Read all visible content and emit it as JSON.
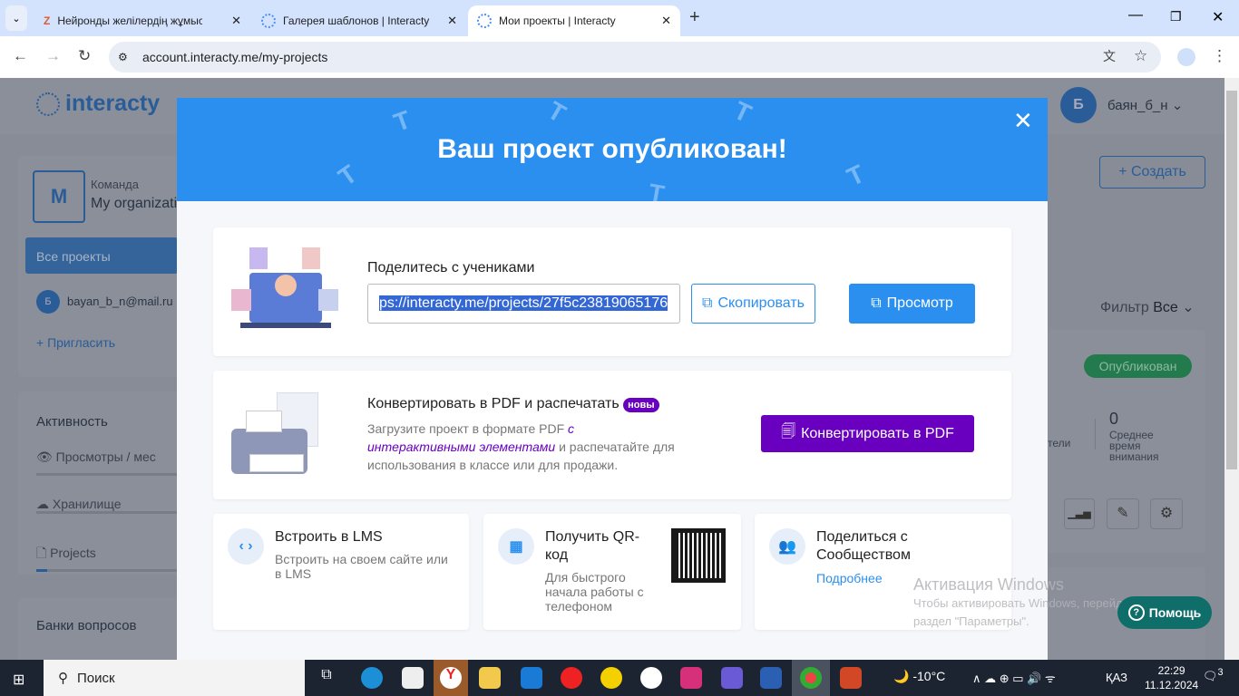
{
  "browser": {
    "tabs": [
      {
        "title": "Нейронды желілердің жұмысы"
      },
      {
        "title": "Галерея шаблонов | Interacty"
      },
      {
        "title": "Мои проекты | Interacty",
        "active": true
      }
    ],
    "url": "account.interacty.me/my-projects"
  },
  "app": {
    "logo": "interacty",
    "user": {
      "initial": "Б",
      "name": "баян_б_н"
    },
    "create_button": "+ Создать",
    "filter_label": "Фильтр",
    "filter_value": "Все",
    "team": {
      "initial": "M",
      "label": "Команда",
      "name": "My organization"
    },
    "sidebar": {
      "all_projects": "Все проекты",
      "member_initial": "Б",
      "member_email": "bayan_b_n@mail.ru",
      "invite": "Пригласить"
    },
    "activity": {
      "title": "Активность",
      "items": [
        {
          "label": "Просмотры / мес",
          "progress": 0
        },
        {
          "label": "Хранилище",
          "progress": 0
        },
        {
          "label": "Projects",
          "progress": 0.05
        }
      ]
    },
    "question_banks": "Банки вопросов",
    "project": {
      "status": "Опубликован",
      "stat_partial": "тели",
      "avg_value": "0",
      "avg_label": "Среднее время внимания"
    },
    "help": "Помощь"
  },
  "modal": {
    "title": "Ваш проект опубликован!",
    "share": {
      "label": "Поделитесь с учениками",
      "url": "ps://interacty.me/projects/27f5c23819065176",
      "copy": "Скопировать",
      "preview": "Просмотр"
    },
    "pdf": {
      "title": "Конвертировать в PDF и распечатать",
      "badge": "новы",
      "desc_1": "Загрузите проект в формате PDF ",
      "desc_link": "с интерактивными элементами",
      "desc_2": " и распечатайте для использования в классе или для продажи.",
      "button": "Конвертировать в PDF"
    },
    "lms": {
      "title": "Встроить в LMS",
      "desc": "Встроить на своем сайте или в LMS"
    },
    "qr": {
      "title": "Получить QR-код",
      "desc": "Для быстрого начала работы с телефоном"
    },
    "community": {
      "title": "Поделиться с Сообществом",
      "link": "Подробнее"
    }
  },
  "watermark": {
    "title": "Активация Windows",
    "text": "Чтобы активировать Windows, перейдите в раздел \"Параметры\"."
  },
  "taskbar": {
    "search": "Поиск",
    "weather": "-10°C",
    "lang": "ҚАЗ",
    "time": "22:29",
    "date": "11.12.2024",
    "notifications": "3"
  },
  "colors": {
    "accent": "#2b8ff0",
    "purple": "#6a00bf",
    "published": "#2d9d5c",
    "help": "#0f6e6a"
  }
}
